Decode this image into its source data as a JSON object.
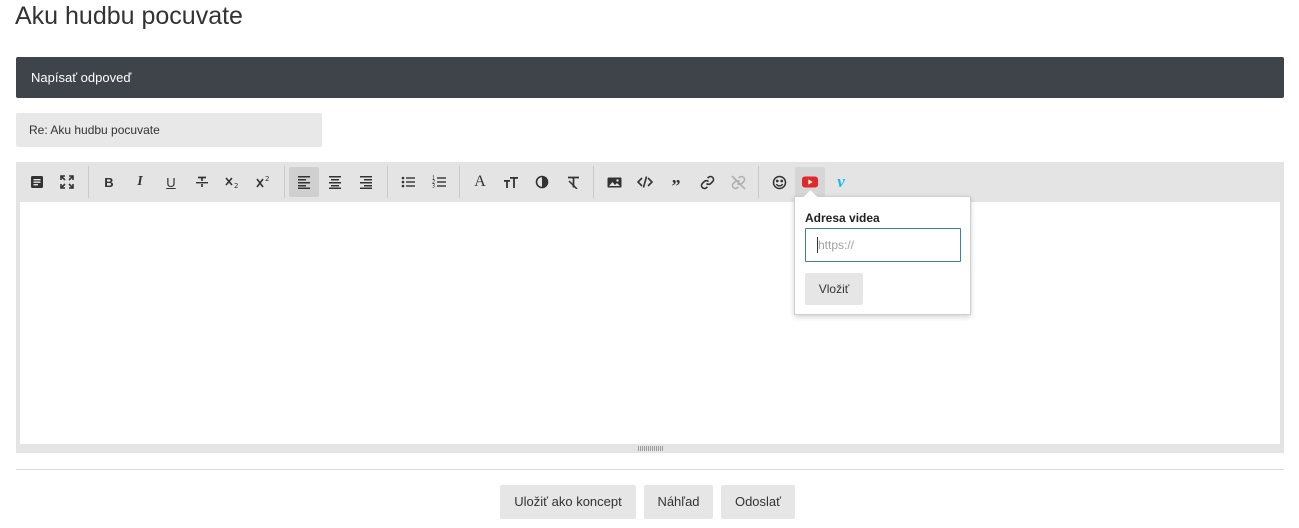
{
  "page": {
    "title": "Aku hudbu pocuvate"
  },
  "reply_bar": {
    "label": "Napísať odpoveď"
  },
  "subject": {
    "value": "Re: Aku hudbu pocuvate"
  },
  "toolbar": {
    "buttons": [
      {
        "icon": "file-icon"
      },
      {
        "icon": "fullscreen-icon"
      },
      {
        "icon": "bold-icon",
        "label": "B"
      },
      {
        "icon": "italic-icon",
        "label": "I"
      },
      {
        "icon": "underline-icon",
        "label": "U"
      },
      {
        "icon": "strikethrough-icon"
      },
      {
        "icon": "subscript-icon"
      },
      {
        "icon": "superscript-icon"
      },
      {
        "icon": "align-left-icon",
        "active": true
      },
      {
        "icon": "align-center-icon"
      },
      {
        "icon": "align-right-icon"
      },
      {
        "icon": "bulleted-list-icon"
      },
      {
        "icon": "numbered-list-icon"
      },
      {
        "icon": "font-icon"
      },
      {
        "icon": "font-size-icon"
      },
      {
        "icon": "contrast-icon"
      },
      {
        "icon": "clear-format-icon"
      },
      {
        "icon": "image-icon"
      },
      {
        "icon": "code-icon"
      },
      {
        "icon": "quote-icon"
      },
      {
        "icon": "link-icon"
      },
      {
        "icon": "unlink-icon"
      },
      {
        "icon": "smiley-icon"
      },
      {
        "icon": "youtube-icon",
        "active": true
      },
      {
        "icon": "vimeo-icon"
      }
    ]
  },
  "video_popup": {
    "label": "Adresa videa",
    "placeholder": "https://",
    "insert_label": "Vložiť"
  },
  "actions": {
    "save_draft": "Uložiť ako koncept",
    "preview": "Náhľad",
    "send": "Odoslať"
  },
  "colors": {
    "header_bar": "#3f434a",
    "youtube_red": "#e02a2a",
    "vimeo_blue": "#1ab7ea",
    "input_focus": "#3a7fb0"
  }
}
